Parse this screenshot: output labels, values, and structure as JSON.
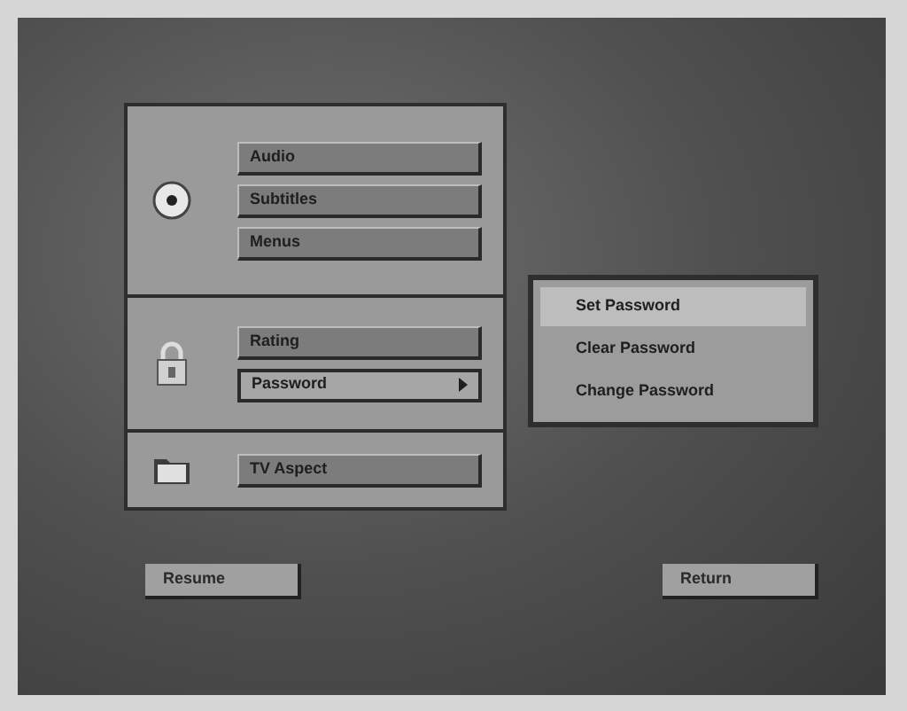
{
  "groups": [
    {
      "kind": "disc",
      "items": [
        {
          "label": "Audio",
          "selected": false,
          "has_submenu": false
        },
        {
          "label": "Subtitles",
          "selected": false,
          "has_submenu": false
        },
        {
          "label": "Menus",
          "selected": false,
          "has_submenu": false
        }
      ]
    },
    {
      "kind": "lock",
      "items": [
        {
          "label": "Rating",
          "selected": false,
          "has_submenu": false
        },
        {
          "label": "Password",
          "selected": true,
          "has_submenu": true
        }
      ]
    },
    {
      "kind": "folder",
      "items": [
        {
          "label": "TV Aspect",
          "selected": false,
          "has_submenu": false
        }
      ]
    }
  ],
  "submenu": {
    "items": [
      {
        "label": "Set Password",
        "selected": true
      },
      {
        "label": "Clear Password",
        "selected": false
      },
      {
        "label": "Change Password",
        "selected": false
      }
    ]
  },
  "buttons": [
    {
      "label": "Resume"
    },
    {
      "label": "Return"
    }
  ]
}
